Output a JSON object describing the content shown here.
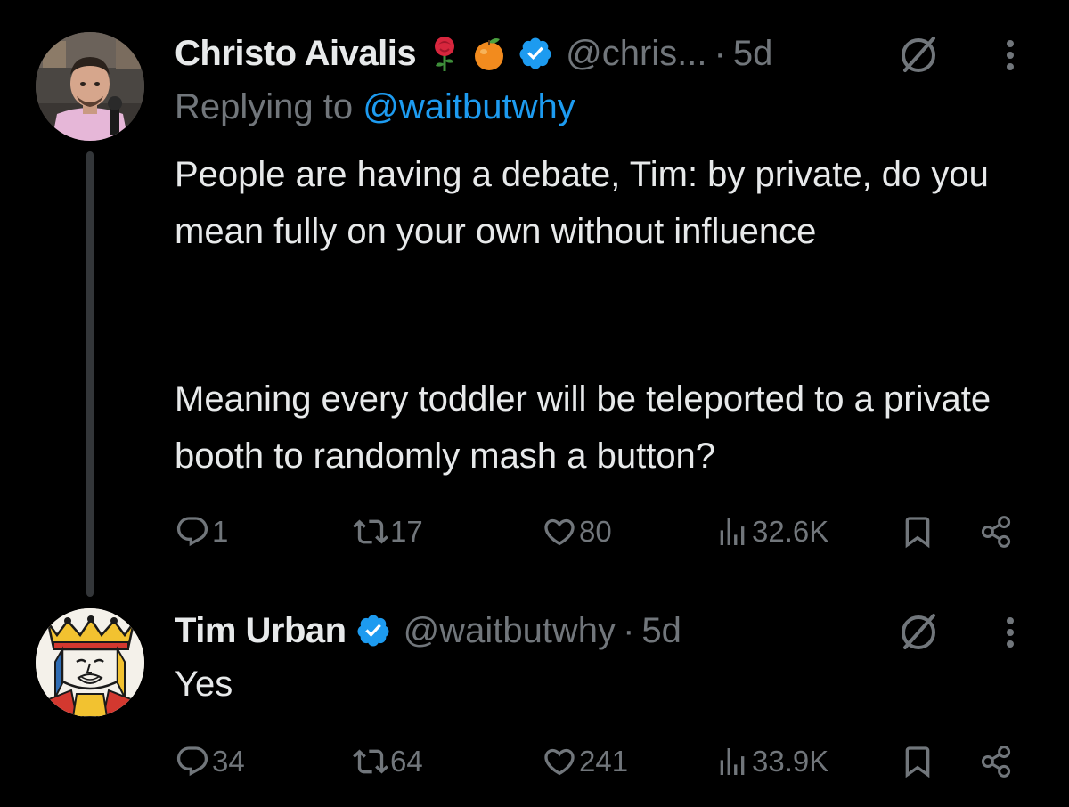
{
  "tweets": [
    {
      "author": {
        "name": "Christo Aivalis",
        "handle": "@chris...",
        "emojis": [
          "rose-emoji",
          "tangerine-emoji"
        ],
        "verified": true
      },
      "time": "5d",
      "separator": "·",
      "replying_prefix": "Replying to ",
      "replying_to": "@waitbutwhy",
      "text_paragraphs": [
        "People are having a debate, Tim: by private, do you mean fully on your own without influence",
        "Meaning every toddler will be teleported to a private booth to randomly mash a button?"
      ],
      "stats": {
        "replies": "1",
        "retweets": "17",
        "likes": "80",
        "views": "32.6K"
      }
    },
    {
      "author": {
        "name": "Tim Urban",
        "handle": "@waitbutwhy",
        "verified": true
      },
      "time": "5d",
      "separator": "·",
      "text": "Yes",
      "stats": {
        "replies": "34",
        "retweets": "64",
        "likes": "241",
        "views": "33.9K"
      }
    }
  ],
  "colors": {
    "background": "#000000",
    "text_primary": "#e7e9ea",
    "text_secondary": "#71767b",
    "link": "#1d9bf0",
    "verified_badge": "#1d9bf0",
    "thread_line": "#333639"
  },
  "icons": [
    "reply-icon",
    "retweet-icon",
    "like-icon",
    "views-icon",
    "bookmark-icon",
    "share-icon",
    "grok-icon",
    "more-icon",
    "verified-badge-icon"
  ]
}
